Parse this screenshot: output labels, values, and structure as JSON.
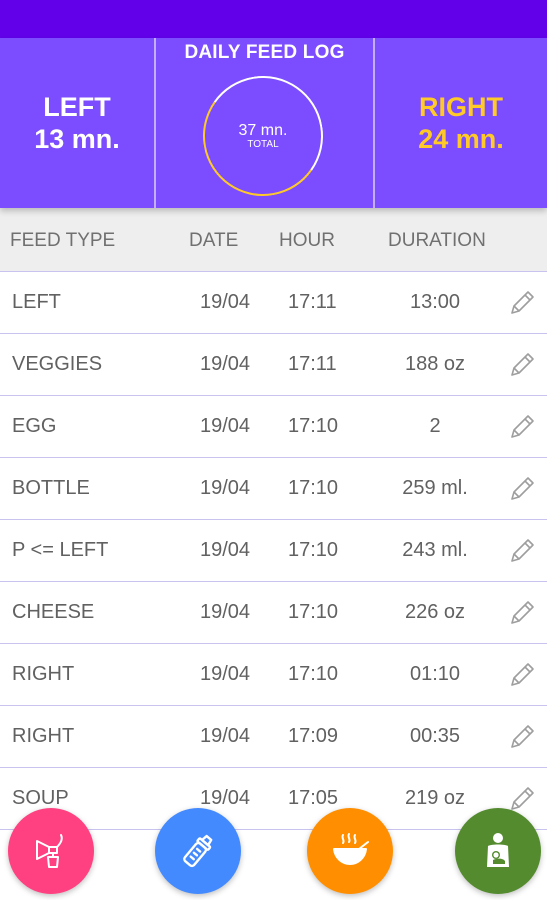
{
  "summary": {
    "left_label": "LEFT",
    "left_value": "13 mn.",
    "title": "DAILY FEED LOG",
    "total_value": "37 mn.",
    "total_label": "TOTAL",
    "right_label": "RIGHT",
    "right_value": "24 mn."
  },
  "table": {
    "headers": {
      "feed_type": "FEED TYPE",
      "date": "DATE",
      "hour": "HOUR",
      "duration": "DURATION"
    },
    "rows": [
      {
        "type": "LEFT",
        "date": "19/04",
        "hour": "17:11",
        "duration": "13:00"
      },
      {
        "type": "VEGGIES",
        "date": "19/04",
        "hour": "17:11",
        "duration": "188 oz"
      },
      {
        "type": "EGG",
        "date": "19/04",
        "hour": "17:10",
        "duration": "2"
      },
      {
        "type": "BOTTLE",
        "date": "19/04",
        "hour": "17:10",
        "duration": "259 ml."
      },
      {
        "type": "P <= LEFT",
        "date": "19/04",
        "hour": "17:10",
        "duration": "243 ml."
      },
      {
        "type": "CHEESE",
        "date": "19/04",
        "hour": "17:10",
        "duration": "226 oz"
      },
      {
        "type": "RIGHT",
        "date": "19/04",
        "hour": "17:10",
        "duration": "01:10"
      },
      {
        "type": "RIGHT",
        "date": "19/04",
        "hour": "17:09",
        "duration": "00:35"
      },
      {
        "type": "SOUP",
        "date": "19/04",
        "hour": "17:05",
        "duration": "219 oz"
      }
    ],
    "row_icon": "pencil-icon"
  },
  "fabs": [
    {
      "icon": "breast-pump-icon",
      "color": "#ff4081"
    },
    {
      "icon": "baby-bottle-icon",
      "color": "#448aff"
    },
    {
      "icon": "food-bowl-icon",
      "color": "#ff8f00"
    },
    {
      "icon": "breastfeeding-icon",
      "color": "#558b2f"
    }
  ],
  "colors": {
    "status_bar": "#6200ea",
    "header_bg": "#7c4dff",
    "accent_yellow": "#ffca28",
    "row_divider": "#c9c3f0"
  }
}
